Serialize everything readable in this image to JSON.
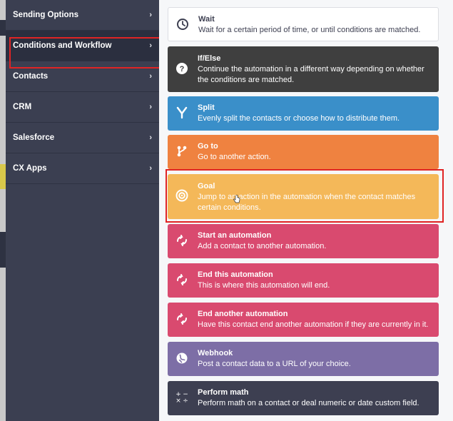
{
  "sidebar": {
    "items": [
      {
        "label": "Sending Options"
      },
      {
        "label": "Conditions and Workflow"
      },
      {
        "label": "Contacts"
      },
      {
        "label": "CRM"
      },
      {
        "label": "Salesforce"
      },
      {
        "label": "CX Apps"
      }
    ],
    "active_item": "Conditions and Workflow",
    "chevron": "›"
  },
  "actions": [
    {
      "title": "Wait",
      "description": "Wait for a certain period of time, or until conditions are matched.",
      "icon": "clock-icon",
      "color": "#ffffff"
    },
    {
      "title": "If/Else",
      "description": "Continue the automation in a different way depending on whether the conditions are matched.",
      "icon": "question-icon",
      "color": "#3f3f3f"
    },
    {
      "title": "Split",
      "description": "Evenly split the contacts or choose how to distribute them.",
      "icon": "split-icon",
      "color": "#3a8fc9"
    },
    {
      "title": "Go to",
      "description": "Go to another action.",
      "icon": "goto-icon",
      "color": "#ef8240"
    },
    {
      "title": "Goal",
      "description": "Jump to an action in the automation when the contact matches certain conditions.",
      "icon": "target-icon",
      "color": "#f4b859"
    },
    {
      "title": "Start an automation",
      "description": "Add a contact to another automation.",
      "icon": "cycle-icon",
      "color": "#d94a6f"
    },
    {
      "title": "End this automation",
      "description": "This is where this automation will end.",
      "icon": "cycle-icon",
      "color": "#d94a6f"
    },
    {
      "title": "End another automation",
      "description": "Have this contact end another automation if they are currently in it.",
      "icon": "cycle-icon",
      "color": "#d94a6f"
    },
    {
      "title": "Webhook",
      "description": "Post a contact data to a URL of your choice.",
      "icon": "webhook-icon",
      "color": "#7d6ea6"
    },
    {
      "title": "Perform math",
      "description": "Perform math on a contact or deal numeric or date custom field.",
      "icon": "math-icon",
      "color": "#3d3f51"
    }
  ],
  "math_icon_glyphs": {
    "plus": "+",
    "minus": "−",
    "times": "×",
    "divide": "÷"
  }
}
